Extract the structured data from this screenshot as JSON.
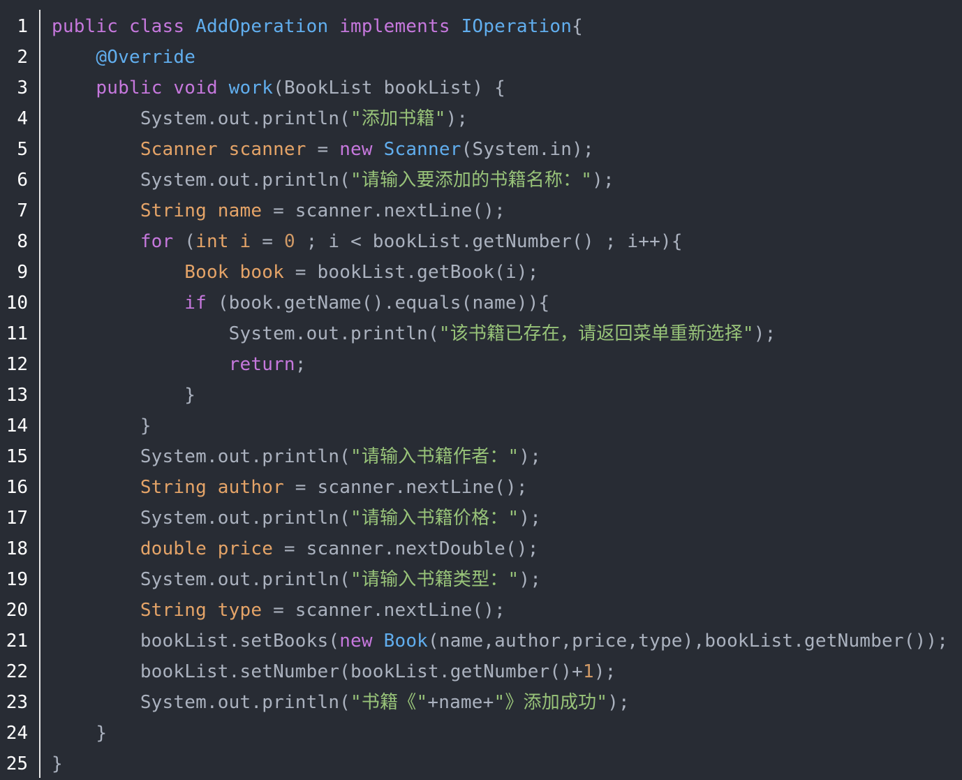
{
  "editor": {
    "language": "java",
    "colors": {
      "background": "#282c34",
      "keyword": "#c678dd",
      "class": "#61aeee",
      "type": "#e5a468",
      "string": "#98c379",
      "number": "#d19a66",
      "default": "#abb2bf"
    },
    "lines": [
      {
        "n": "1",
        "t": [
          [
            "kw",
            "public class "
          ],
          [
            "cls",
            "AddOperation "
          ],
          [
            "kw",
            "implements "
          ],
          [
            "cls",
            "IOperation"
          ],
          [
            "p",
            "{"
          ]
        ]
      },
      {
        "n": "2",
        "t": [
          [
            "p",
            "    "
          ],
          [
            "ann",
            "@Override"
          ]
        ]
      },
      {
        "n": "3",
        "t": [
          [
            "p",
            "    "
          ],
          [
            "kw",
            "public void "
          ],
          [
            "fn",
            "work"
          ],
          [
            "p",
            "(BookList bookList) {"
          ]
        ]
      },
      {
        "n": "4",
        "t": [
          [
            "p",
            "        System.out.println("
          ],
          [
            "str",
            "\"添加书籍\""
          ],
          [
            "p",
            ");"
          ]
        ]
      },
      {
        "n": "5",
        "t": [
          [
            "p",
            "        "
          ],
          [
            "typeg",
            "Scanner scanner"
          ],
          [
            "p",
            " = "
          ],
          [
            "kw",
            "new "
          ],
          [
            "cls",
            "Scanner"
          ],
          [
            "p",
            "(System.in);"
          ]
        ]
      },
      {
        "n": "6",
        "t": [
          [
            "p",
            "        System.out.println("
          ],
          [
            "str",
            "\"请输入要添加的书籍名称：\""
          ],
          [
            "p",
            ");"
          ]
        ]
      },
      {
        "n": "7",
        "t": [
          [
            "p",
            "        "
          ],
          [
            "typeg",
            "String name"
          ],
          [
            "p",
            " = scanner.nextLine();"
          ]
        ]
      },
      {
        "n": "8",
        "t": [
          [
            "p",
            "        "
          ],
          [
            "kw",
            "for "
          ],
          [
            "p",
            "("
          ],
          [
            "typeg",
            "int i"
          ],
          [
            "p",
            " = "
          ],
          [
            "num",
            "0"
          ],
          [
            "p",
            " ; i < bookList.getNumber() ; i++){"
          ]
        ]
      },
      {
        "n": "9",
        "t": [
          [
            "p",
            "            "
          ],
          [
            "typeg",
            "Book book"
          ],
          [
            "p",
            " = bookList.getBook(i);"
          ]
        ]
      },
      {
        "n": "10",
        "t": [
          [
            "p",
            "            "
          ],
          [
            "kw",
            "if "
          ],
          [
            "p",
            "(book.getName().equals(name)){"
          ]
        ]
      },
      {
        "n": "11",
        "t": [
          [
            "p",
            "                System.out.println("
          ],
          [
            "str",
            "\"该书籍已存在，请返回菜单重新选择\""
          ],
          [
            "p",
            ");"
          ]
        ]
      },
      {
        "n": "12",
        "t": [
          [
            "p",
            "                "
          ],
          [
            "kw",
            "return"
          ],
          [
            "p",
            ";"
          ]
        ]
      },
      {
        "n": "13",
        "t": [
          [
            "p",
            "            }"
          ]
        ]
      },
      {
        "n": "14",
        "t": [
          [
            "p",
            "        }"
          ]
        ]
      },
      {
        "n": "15",
        "t": [
          [
            "p",
            "        System.out.println("
          ],
          [
            "str",
            "\"请输入书籍作者：\""
          ],
          [
            "p",
            ");"
          ]
        ]
      },
      {
        "n": "16",
        "t": [
          [
            "p",
            "        "
          ],
          [
            "typeg",
            "String author"
          ],
          [
            "p",
            " = scanner.nextLine();"
          ]
        ]
      },
      {
        "n": "17",
        "t": [
          [
            "p",
            "        System.out.println("
          ],
          [
            "str",
            "\"请输入书籍价格：\""
          ],
          [
            "p",
            ");"
          ]
        ]
      },
      {
        "n": "18",
        "t": [
          [
            "p",
            "        "
          ],
          [
            "typeg",
            "double price"
          ],
          [
            "p",
            " = scanner.nextDouble();"
          ]
        ]
      },
      {
        "n": "19",
        "t": [
          [
            "p",
            "        System.out.println("
          ],
          [
            "str",
            "\"请输入书籍类型：\""
          ],
          [
            "p",
            ");"
          ]
        ]
      },
      {
        "n": "20",
        "t": [
          [
            "p",
            "        "
          ],
          [
            "typeg",
            "String type"
          ],
          [
            "p",
            " = scanner.nextLine();"
          ]
        ]
      },
      {
        "n": "21",
        "t": [
          [
            "p",
            "        bookList.setBooks("
          ],
          [
            "kw",
            "new "
          ],
          [
            "cls",
            "Book"
          ],
          [
            "p",
            "(name,author,price,type),bookList.getNumber());"
          ]
        ]
      },
      {
        "n": "22",
        "t": [
          [
            "p",
            "        bookList.setNumber(bookList.getNumber()+"
          ],
          [
            "num",
            "1"
          ],
          [
            "p",
            ");"
          ]
        ]
      },
      {
        "n": "23",
        "t": [
          [
            "p",
            "        System.out.println("
          ],
          [
            "str",
            "\"书籍《\""
          ],
          [
            "p",
            "+name+"
          ],
          [
            "str",
            "\"》添加成功\""
          ],
          [
            "p",
            ");"
          ]
        ]
      },
      {
        "n": "24",
        "t": [
          [
            "p",
            "    }"
          ]
        ]
      },
      {
        "n": "25",
        "t": [
          [
            "p",
            "}"
          ]
        ]
      }
    ]
  }
}
